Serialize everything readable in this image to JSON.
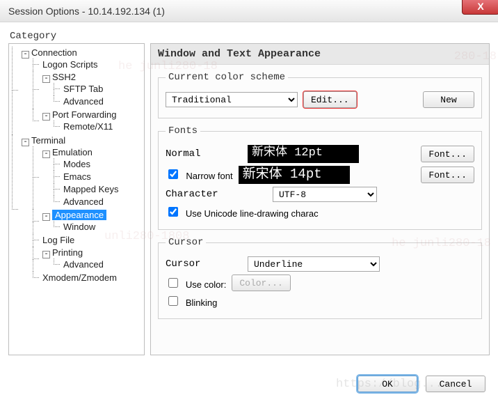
{
  "window": {
    "title": "Session Options - 10.14.192.134 (1)"
  },
  "category_label": "Category",
  "tree": {
    "connection": "Connection",
    "logon_scripts": "Logon Scripts",
    "ssh2": "SSH2",
    "sftp_tab": "SFTP Tab",
    "ssh_adv": "Advanced",
    "port_fwd": "Port Forwarding",
    "remote_x11": "Remote/X11",
    "terminal": "Terminal",
    "emulation": "Emulation",
    "modes": "Modes",
    "emacs": "Emacs",
    "mapped_keys": "Mapped Keys",
    "emu_adv": "Advanced",
    "appearance": "Appearance",
    "window": "Window",
    "log_file": "Log File",
    "printing": "Printing",
    "print_adv": "Advanced",
    "xmodem": "Xmodem/Zmodem"
  },
  "panel": {
    "heading": "Window and Text Appearance",
    "scheme": {
      "legend": "Current color scheme",
      "value": "Traditional",
      "edit": "Edit...",
      "new": "New"
    },
    "fonts": {
      "legend": "Fonts",
      "normal_label": "Normal",
      "normal_preview": "新宋体 12pt",
      "narrow_label": "Narrow font",
      "narrow_preview": "新宋体  14pt",
      "font_btn": "Font...",
      "character_label": "Character",
      "encoding": "UTF-8",
      "unicode_label": "Use Unicode line-drawing charac"
    },
    "cursor": {
      "legend": "Cursor",
      "label": "Cursor",
      "style": "Underline",
      "use_color_label": "Use color:",
      "color_btn": "Color...",
      "blinking_label": "Blinking"
    }
  },
  "buttons": {
    "ok": "OK",
    "cancel": "Cancel"
  }
}
